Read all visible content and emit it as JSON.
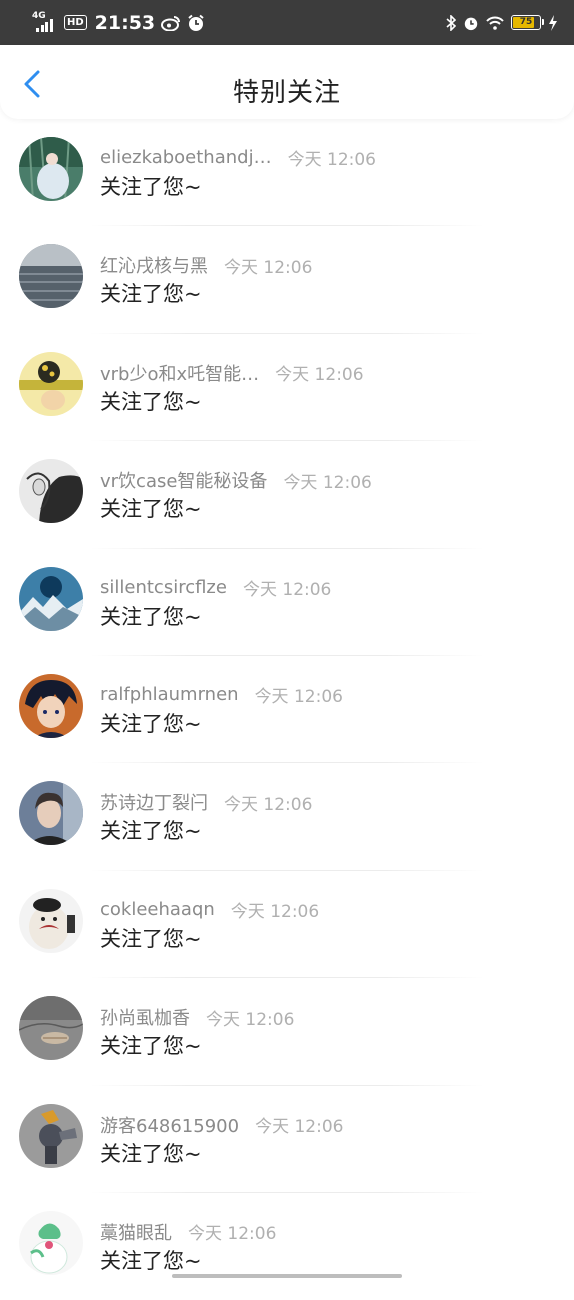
{
  "status_bar": {
    "network": "4G",
    "hd": "HD",
    "time": "21:53",
    "battery": "75",
    "battery_level": 0.75,
    "icons": [
      "signal-icon",
      "weibo-icon",
      "alarm-icon",
      "bluetooth-icon",
      "alarm-icon",
      "wifi-icon",
      "battery-icon",
      "charging-icon"
    ]
  },
  "header": {
    "title": "特别关注",
    "back_icon": "chevron-left-icon"
  },
  "items": [
    {
      "name": "eliezkaboethandj…",
      "time": "今天 12:06",
      "action": "关注了您~"
    },
    {
      "name": "红沁戌核与黑",
      "time": "今天 12:06",
      "action": "关注了您~"
    },
    {
      "name": "vrb少o和x吒智能…",
      "time": "今天 12:06",
      "action": "关注了您~"
    },
    {
      "name": "vr饮case智能秘设备",
      "time": "今天 12:06",
      "action": "关注了您~"
    },
    {
      "name": "sillentcsircflze",
      "time": "今天 12:06",
      "action": "关注了您~"
    },
    {
      "name": "ralfphlaumrnen",
      "time": "今天 12:06",
      "action": "关注了您~"
    },
    {
      "name": "苏诗边丁裂闩",
      "time": "今天 12:06",
      "action": "关注了您~"
    },
    {
      "name": "cokleehaaqn",
      "time": "今天 12:06",
      "action": "关注了您~"
    },
    {
      "name": "孙尚虱枷香",
      "time": "今天 12:06",
      "action": "关注了您~"
    },
    {
      "name": "游客648615900",
      "time": "今天 12:06",
      "action": "关注了您~"
    },
    {
      "name": "藁猫眼乱",
      "time": "今天 12:06",
      "action": "关注了您~"
    }
  ]
}
